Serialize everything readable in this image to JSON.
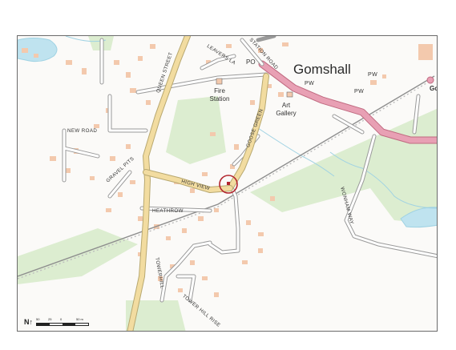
{
  "map": {
    "place_name": "Gomshall",
    "place_name_cut": "Go",
    "labels": {
      "queen_street": "QUEEN STREET",
      "leavers_la": "LEAVERS LA",
      "station_road": "STATION ROAD",
      "po": "PO",
      "pw_1": "PW",
      "pw_2": "PW",
      "pw_3": "PW",
      "fire_station": "Fire Station",
      "art_gallery": "Art Gallery",
      "new_road": "NEW ROAD",
      "gravel_pits": "GRAVEL PITS",
      "high_view": "HIGH VIEW",
      "goose_green": "GOOSE GREEN",
      "heathrow": "HEATHROW",
      "towerhill": "TOWERHILL",
      "towerhill_rise": "TOWER HILL RISE",
      "wonham_way": "WONHAM WAY"
    },
    "colors": {
      "main_road": "#e8a0b4",
      "b_road": "#f2dca0",
      "minor_road": "#9a9a9a",
      "building": "#f3c9ad",
      "green": "#dcedd0",
      "water": "#bfe3ef",
      "railway": "#8e8e8e",
      "marker": "#b3262e"
    },
    "icons": [
      "north-arrow-icon",
      "location-marker-icon"
    ]
  },
  "scale": {
    "north": "N",
    "ticks": [
      "50",
      "25",
      "0",
      "",
      "50 m"
    ]
  }
}
